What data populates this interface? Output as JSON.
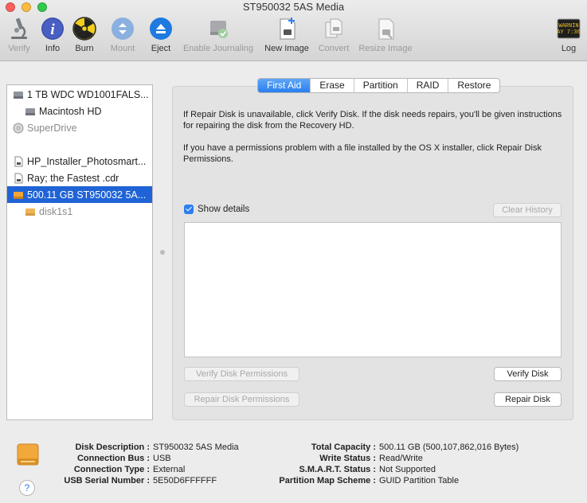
{
  "window": {
    "title": "ST950032 5AS Media"
  },
  "toolbar": {
    "verify": "Verify",
    "info": "Info",
    "burn": "Burn",
    "mount": "Mount",
    "eject": "Eject",
    "enable_journaling": "Enable Journaling",
    "new_image": "New Image",
    "convert": "Convert",
    "resize_image": "Resize Image",
    "log": "Log",
    "log_icon_text": "WARNIN\nAY 7:36"
  },
  "sidebar": {
    "items": [
      {
        "label": "1 TB WDC WD1001FALS..."
      },
      {
        "label": "Macintosh HD"
      },
      {
        "label": "SuperDrive"
      },
      {
        "label": "HP_Installer_Photosmart..."
      },
      {
        "label": "Ray; the Fastest .cdr"
      },
      {
        "label": "500.11 GB ST950032 5A..."
      },
      {
        "label": "disk1s1"
      }
    ]
  },
  "tabs": [
    "First Aid",
    "Erase",
    "Partition",
    "RAID",
    "Restore"
  ],
  "first_aid": {
    "para1": "If Repair Disk is unavailable, click Verify Disk. If the disk needs repairs, you'll be given instructions for repairing the disk from the Recovery HD.",
    "para2": "If you have a permissions problem with a file installed by the OS X installer, click Repair Disk Permissions.",
    "show_details": "Show details",
    "clear_history": "Clear History",
    "verify_permissions": "Verify Disk Permissions",
    "verify_disk": "Verify Disk",
    "repair_permissions": "Repair Disk Permissions",
    "repair_disk": "Repair Disk"
  },
  "info": {
    "disk_description_label": "Disk Description :",
    "disk_description": "ST950032 5AS Media",
    "connection_bus_label": "Connection Bus :",
    "connection_bus": "USB",
    "connection_type_label": "Connection Type :",
    "connection_type": "External",
    "usb_serial_label": "USB Serial Number :",
    "usb_serial": "5E50D6FFFFFF",
    "total_capacity_label": "Total Capacity :",
    "total_capacity": "500.11 GB (500,107,862,016 Bytes)",
    "write_status_label": "Write Status :",
    "write_status": "Read/Write",
    "smart_status_label": "S.M.A.R.T. Status :",
    "smart_status": "Not Supported",
    "partition_scheme_label": "Partition Map Scheme :",
    "partition_scheme": "GUID Partition Table",
    "help": "?"
  },
  "colors": {
    "accent": "#2a7ff0",
    "selection": "#1f63d6"
  }
}
